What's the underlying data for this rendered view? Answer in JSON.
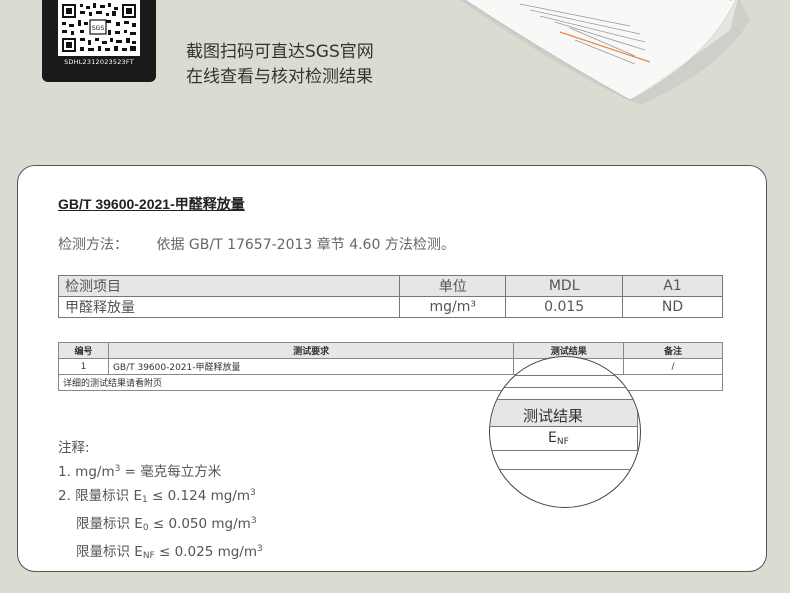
{
  "header": {
    "qr_code_id": "SDHL2312023523FT",
    "qr_center_label": "SGS",
    "scan_line1": "截图扫码可直达SGS官网",
    "scan_line2": "在线查看与核对检测结果"
  },
  "document": {
    "title": "GB/T 39600-2021-甲醛释放量",
    "method_label": "检测方法：",
    "method_text": "依据 GB/T 17657-2013 章节 4.60 方法检测。",
    "table1": {
      "headers": [
        "检测项目",
        "单位",
        "MDL",
        "A1"
      ],
      "row": [
        "甲醛释放量",
        "mg/m³",
        "0.015",
        "ND"
      ]
    },
    "table2": {
      "headers": [
        "编号",
        "测试要求",
        "测试结果",
        "备注"
      ],
      "row": [
        "1",
        "GB/T 39600-2021-甲醛释放量",
        "",
        "/"
      ],
      "footer": "详细的测试结果请看附页"
    },
    "magnifier": {
      "header": "测试结果",
      "value_main": "E",
      "value_sub": "NF"
    },
    "notes": {
      "title": "注释:",
      "n1_pre": "1. mg/m",
      "n1_sup": "3",
      "n1_post": " = 毫克每立方米",
      "n2_pre": "2. 限量标识 E",
      "n2_sub": "1",
      "n2_post": "≤ 0.124 mg/m",
      "n2_sup": "3",
      "n3_pre": "限量标识 E",
      "n3_sub": "0",
      "n3_post": "≤ 0.050 mg/m",
      "n3_sup": "3",
      "n4_pre": "限量标识 E",
      "n4_sub": "NF",
      "n4_post": "≤ 0.025 mg/m",
      "n4_sup": "3"
    }
  }
}
